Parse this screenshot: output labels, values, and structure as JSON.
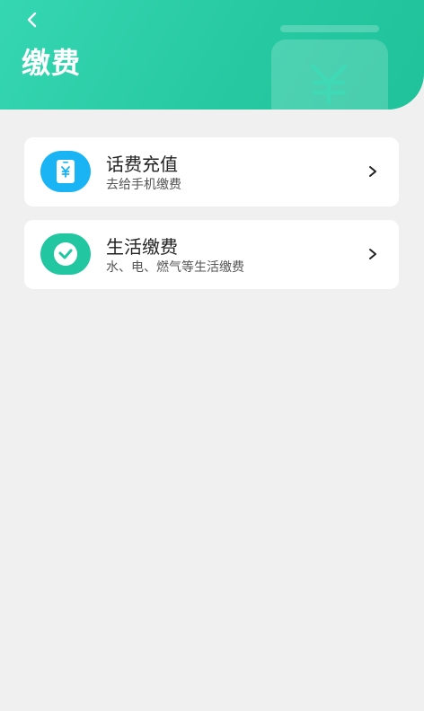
{
  "header": {
    "title": "缴费",
    "back_icon": "chevron-left-icon",
    "deco_icon": "yen-wallet-icon",
    "color": "#27c9a2"
  },
  "items": [
    {
      "title": "话费充值",
      "subtitle": "去给手机缴费",
      "icon": "phone-yen-icon",
      "icon_color": "#1ab4f5"
    },
    {
      "title": "生活缴费",
      "subtitle": "水、电、燃气等生活缴费",
      "icon": "check-circle-icon",
      "icon_color": "#22c7a1"
    }
  ],
  "background_color": "#f0f0f0"
}
